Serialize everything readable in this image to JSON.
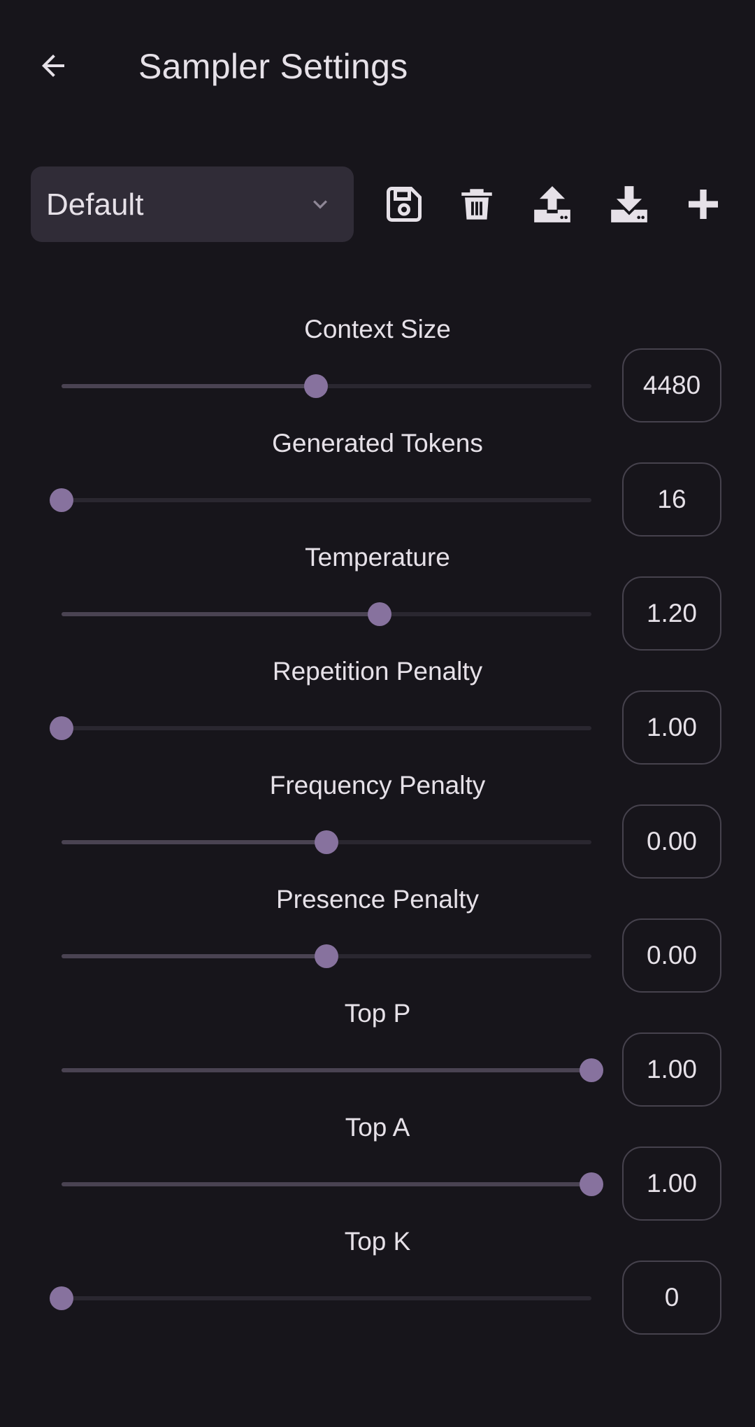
{
  "header": {
    "title": "Sampler Settings",
    "back_icon": "arrow-left-icon"
  },
  "toolbar": {
    "preset_value": "Default",
    "actions": [
      {
        "name": "save",
        "icon": "floppy-disk-icon"
      },
      {
        "name": "delete",
        "icon": "trash-icon"
      },
      {
        "name": "export",
        "icon": "upload-icon"
      },
      {
        "name": "import",
        "icon": "download-icon"
      },
      {
        "name": "add",
        "icon": "plus-icon"
      }
    ]
  },
  "colors": {
    "background": "#17151b",
    "select_bg": "#302c37",
    "accent": "#87729e",
    "track": "#2a2730",
    "track_active": "#4a4352",
    "box_border": "#46424d",
    "text": "#e6e1e8"
  },
  "settings": [
    {
      "label": "Context Size",
      "value": "4480",
      "fraction": 0.48
    },
    {
      "label": "Generated Tokens",
      "value": "16",
      "fraction": 0.0
    },
    {
      "label": "Temperature",
      "value": "1.20",
      "fraction": 0.6
    },
    {
      "label": "Repetition Penalty",
      "value": "1.00",
      "fraction": 0.0
    },
    {
      "label": "Frequency Penalty",
      "value": "0.00",
      "fraction": 0.5
    },
    {
      "label": "Presence Penalty",
      "value": "0.00",
      "fraction": 0.5
    },
    {
      "label": "Top P",
      "value": "1.00",
      "fraction": 1.0
    },
    {
      "label": "Top A",
      "value": "1.00",
      "fraction": 1.0
    },
    {
      "label": "Top K",
      "value": "0",
      "fraction": 0.0
    }
  ]
}
